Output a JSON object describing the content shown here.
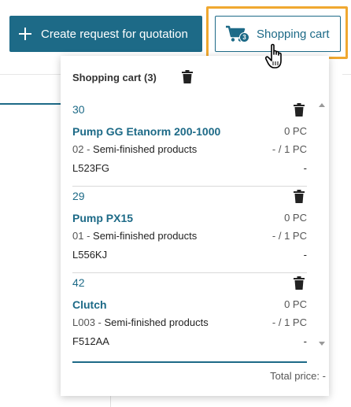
{
  "header": {
    "create_rfq_label": "Create request for quotation",
    "cart_label": "Shopping cart",
    "cart_badge": "3"
  },
  "cart": {
    "title": "Shopping cart (3)",
    "items": [
      {
        "position": "30",
        "name": "Pump GG Etanorm 200-1000",
        "qty": "0 PC",
        "code": "02 -",
        "category": "Semi-finished products",
        "qty_secondary": "- / 1 PC",
        "reference": "L523FG",
        "price": "-"
      },
      {
        "position": "29",
        "name": "Pump PX15",
        "qty": "0 PC",
        "code": "01 -",
        "category": "Semi-finished products",
        "qty_secondary": "- / 1 PC",
        "reference": "L556KJ",
        "price": "-"
      },
      {
        "position": "42",
        "name": "Clutch",
        "qty": "0 PC",
        "code": "L003 -",
        "category": "Semi-finished products",
        "qty_secondary": "- / 1 PC",
        "reference": "F512AA",
        "price": "-"
      }
    ],
    "total_label": "Total price:",
    "total_value": "-"
  },
  "colors": {
    "primary": "#1d6a87",
    "highlight": "#f0a830"
  },
  "icons": [
    "plus-icon",
    "shopping-cart-icon",
    "trash-icon",
    "hand-cursor-icon",
    "scroll-up-icon",
    "scroll-down-icon"
  ]
}
